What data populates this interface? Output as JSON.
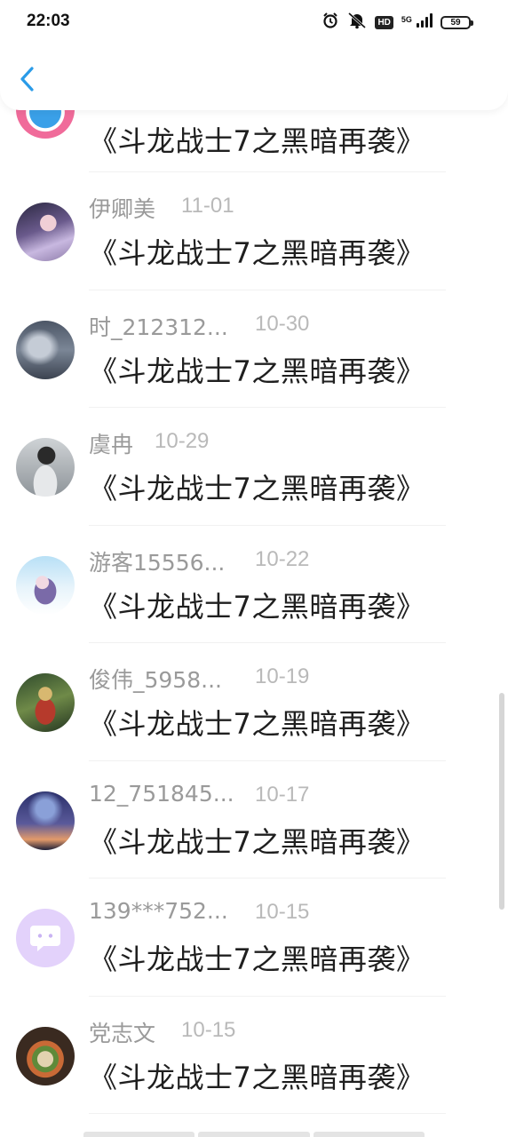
{
  "status_bar": {
    "time": "22:03",
    "network": "5G",
    "hd": "HD",
    "battery": "59"
  },
  "header": {
    "back_icon": "chevron-left-icon",
    "accent_color": "#2a9be8"
  },
  "items": [
    {
      "username": "",
      "date": "",
      "title": "《斗龙战士7之黑暗再袭》"
    },
    {
      "username": "伊卿美",
      "date": "11-01",
      "title": "《斗龙战士7之黑暗再袭》"
    },
    {
      "username": "时_212312...",
      "date": "10-30",
      "title": "《斗龙战士7之黑暗再袭》"
    },
    {
      "username": "虞冉",
      "date": "10-29",
      "title": "《斗龙战士7之黑暗再袭》"
    },
    {
      "username": "游客15556...",
      "date": "10-22",
      "title": "《斗龙战士7之黑暗再袭》"
    },
    {
      "username": "俊伟_5958...",
      "date": "10-19",
      "title": "《斗龙战士7之黑暗再袭》"
    },
    {
      "username": "12_751845...",
      "date": "10-17",
      "title": "《斗龙战士7之黑暗再袭》"
    },
    {
      "username": "139***752...",
      "date": "10-15",
      "title": "《斗龙战士7之黑暗再袭》"
    },
    {
      "username": "党志文",
      "date": "10-15",
      "title": "《斗龙战士7之黑暗再袭》"
    }
  ]
}
